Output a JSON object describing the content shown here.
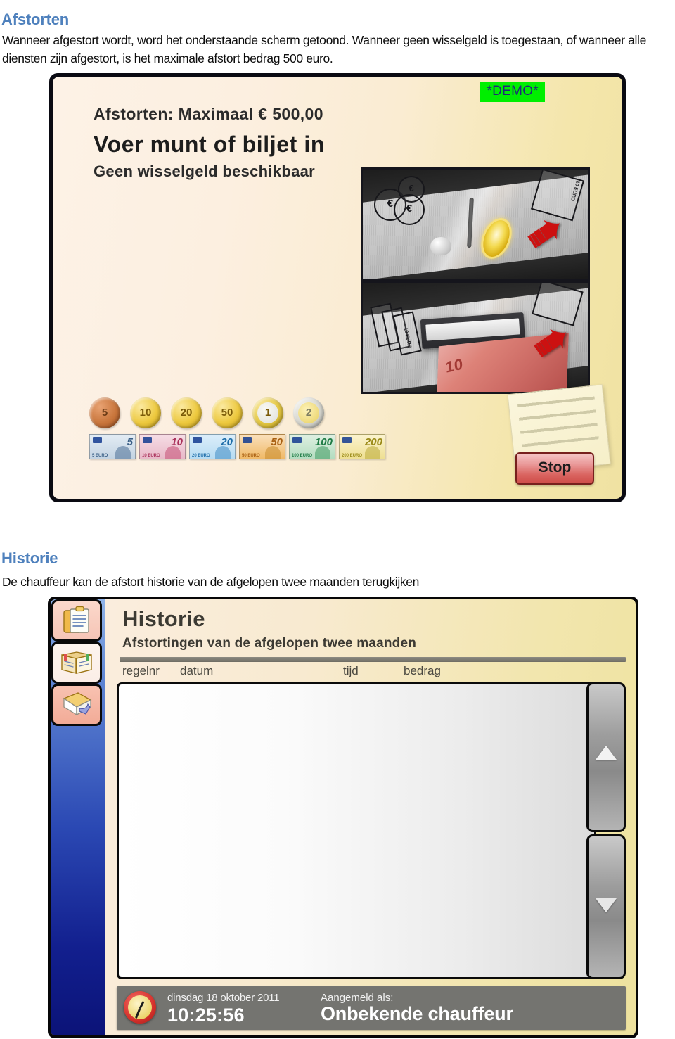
{
  "document": {
    "section1": {
      "heading": "Afstorten",
      "paragraph": "Wanneer afgestort wordt, word het onderstaande scherm getoond.  Wanneer geen wisselgeld is toegestaan, of wanneer alle diensten zijn afgestort, is het maximale afstort bedrag 500 euro."
    },
    "section2": {
      "heading": "Historie",
      "paragraph": "De chauffeur kan de afstort historie van de afgelopen twee maanden terugkijken"
    },
    "heading_color": "#4f81bd"
  },
  "kiosk_screen": {
    "demo_badge": "*DEMO*",
    "demo_badge_bg": "#00ef00",
    "demo_badge_color": "#1f2a78",
    "title_line": "Afstorten: Maximaal € 500,00",
    "instruction": "Voer munt of biljet in",
    "subinstruction": "Geen wisselgeld beschikbaar",
    "stop_button": "Stop",
    "coin_photo": {
      "name": "coin-slot-photo",
      "outline_coin_labels": [
        "€",
        "€",
        "€"
      ],
      "note_corner_label": "10 EURO"
    },
    "note_photo": {
      "name": "banknote-slot-photo",
      "outline_note_labels": [
        "€",
        "€",
        "€"
      ],
      "note_corner_label": "10 EURO",
      "inserted_note": "10"
    },
    "coins": [
      {
        "value": "5",
        "kind": "copper"
      },
      {
        "value": "10",
        "kind": "gold"
      },
      {
        "value": "20",
        "kind": "gold"
      },
      {
        "value": "50",
        "kind": "gold"
      },
      {
        "value": "1",
        "kind": "bi1"
      },
      {
        "value": "2",
        "kind": "bi2"
      }
    ],
    "banknotes": [
      {
        "value": "5",
        "small": "5 EURO",
        "cls": "b5"
      },
      {
        "value": "10",
        "small": "10 EURO",
        "cls": "b10"
      },
      {
        "value": "20",
        "small": "20 EURO",
        "cls": "b20"
      },
      {
        "value": "50",
        "small": "50 EURO",
        "cls": "b50"
      },
      {
        "value": "100",
        "small": "100 EURO",
        "cls": "b100"
      },
      {
        "value": "200",
        "small": "200 EURO",
        "cls": "b200"
      }
    ]
  },
  "historie_window": {
    "title": "Historie",
    "subtitle": "Afstortingen van de afgelopen twee maanden",
    "columns": {
      "regelnr": "regelnr",
      "datum": "datum",
      "tijd": "tijd",
      "bedrag": "bedrag"
    },
    "rows": [],
    "sidebar_buttons": [
      {
        "icon": "clipboard-notes-icon"
      },
      {
        "icon": "open-book-icon"
      },
      {
        "icon": "envelope-reply-icon"
      }
    ],
    "scroll_up_icon": "triangle-up-icon",
    "scroll_down_icon": "triangle-down-icon",
    "statusbar": {
      "clock_icon": "clock-icon",
      "date": "dinsdag 18 oktober 2011",
      "time": "10:25:56",
      "login_label": "Aangemeld als:",
      "user": "Onbekende chauffeur"
    }
  }
}
